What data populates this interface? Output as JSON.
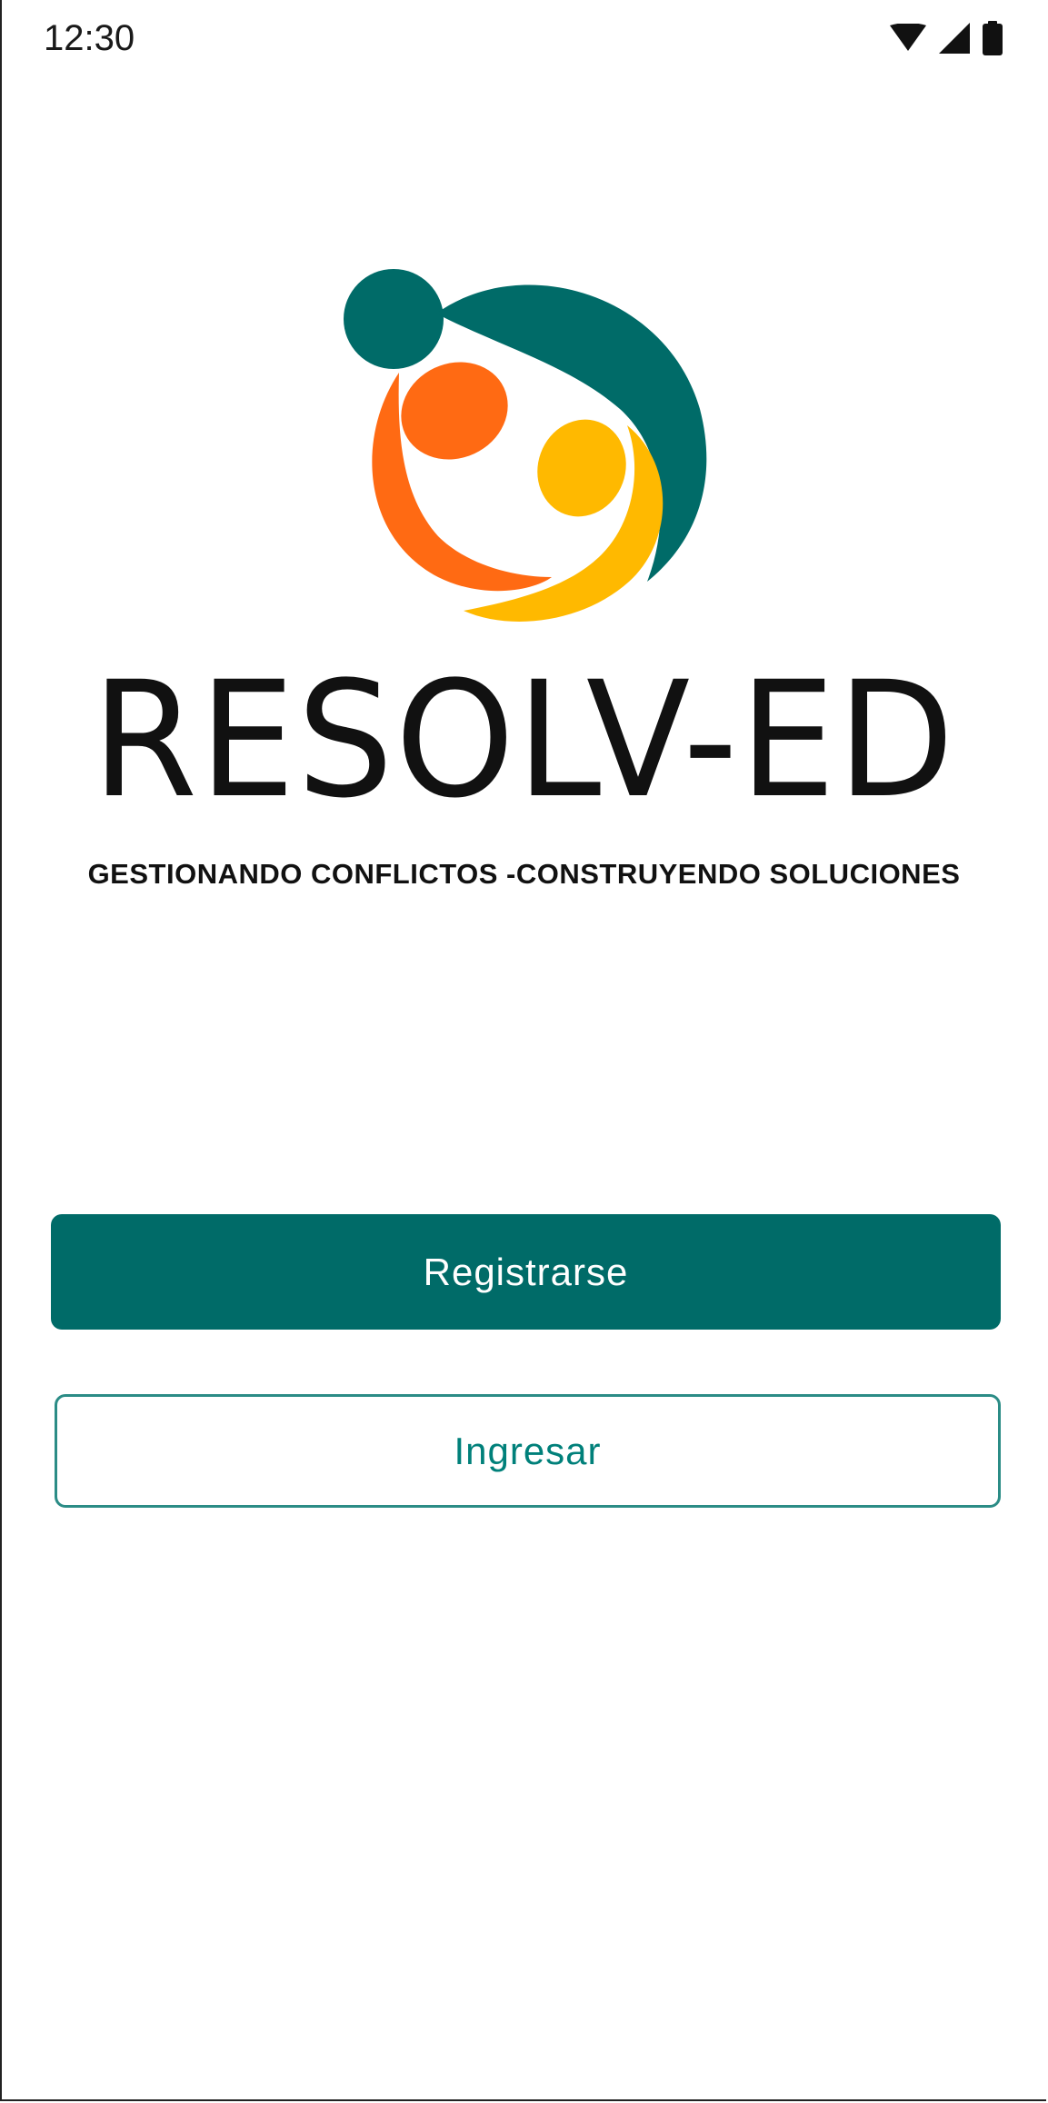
{
  "status_bar": {
    "time": "12:30",
    "icons": [
      "wifi-icon",
      "signal-icon",
      "battery-icon"
    ]
  },
  "brand": {
    "wordmark": "RESOLV-ED",
    "tagline": "GESTIONANDO CONFLICTOS -CONSTRUYENDO SOLUCIONES",
    "colors": {
      "teal": "#006b68",
      "orange": "#ff6a13",
      "yellow": "#ffb900"
    }
  },
  "actions": {
    "register_label": "Registrarse",
    "login_label": "Ingresar"
  },
  "theme": {
    "primary": "#006b68",
    "secondary_text": "#00807a",
    "background": "#ffffff"
  }
}
